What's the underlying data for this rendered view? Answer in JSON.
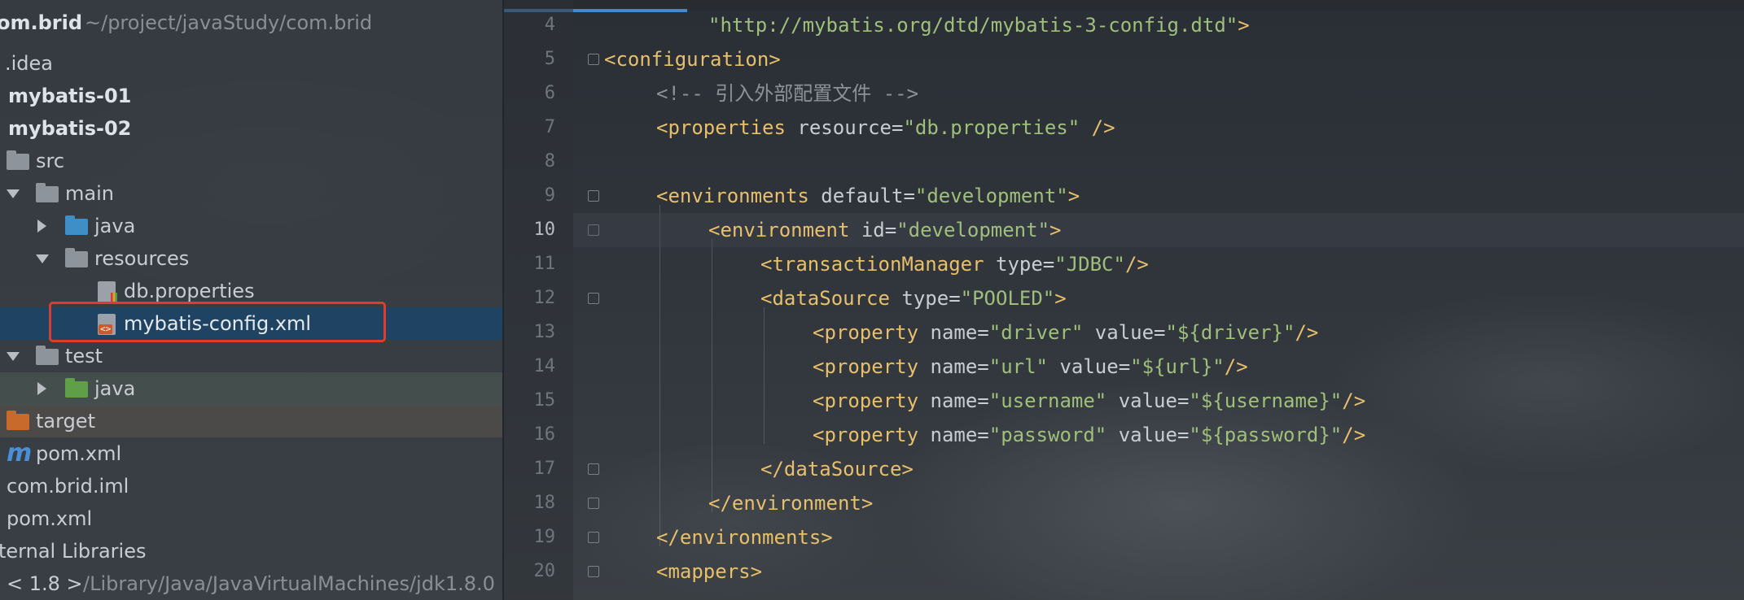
{
  "project_tree": {
    "root": {
      "name": "om.brid",
      "path": "~/project/javaStudy/com.brid"
    },
    "items": [
      {
        "label": ".idea"
      },
      {
        "label": "mybatis-01"
      },
      {
        "label": "mybatis-02"
      },
      {
        "label": "src"
      },
      {
        "label": "main"
      },
      {
        "label": "java"
      },
      {
        "label": "resources"
      },
      {
        "label": "db.properties"
      },
      {
        "label": "mybatis-config.xml"
      },
      {
        "label": "test"
      },
      {
        "label": "java"
      },
      {
        "label": "target"
      },
      {
        "label": "pom.xml"
      },
      {
        "label": "com.brid.iml"
      },
      {
        "label": "pom.xml"
      },
      {
        "label": "ternal Libraries"
      },
      {
        "label": "< 1.8 >",
        "path": "/Library/Java/JavaVirtualMachines/jdk1.8.0"
      }
    ],
    "selected": "mybatis-config.xml"
  },
  "editor": {
    "current_line": "10",
    "lines": [
      {
        "num": "4"
      },
      {
        "num": "5"
      },
      {
        "num": "6"
      },
      {
        "num": "7"
      },
      {
        "num": "8"
      },
      {
        "num": "9"
      },
      {
        "num": "10"
      },
      {
        "num": "11"
      },
      {
        "num": "12"
      },
      {
        "num": "13"
      },
      {
        "num": "14"
      },
      {
        "num": "15"
      },
      {
        "num": "16"
      },
      {
        "num": "17"
      },
      {
        "num": "18"
      },
      {
        "num": "19"
      },
      {
        "num": "20"
      }
    ],
    "code": {
      "l4_val": "\"http://mybatis.org/dtd/mybatis-3-config.dtd\"",
      "l4_close": ">",
      "l5_tag": "<configuration>",
      "l6_comment": "<!-- 引入外部配置文件 -->",
      "l7_tag": "<properties",
      "l7_attr": " resource=",
      "l7_val": "\"db.properties\"",
      "l7_close": " />",
      "l9_tag": "<environments",
      "l9_attr": " default=",
      "l9_val": "\"development\"",
      "l9_close": ">",
      "l10_tag": "<environment",
      "l10_attr": " id=",
      "l10_val": "\"development\"",
      "l10_close": ">",
      "l11_tag": "<transactionManager",
      "l11_attr": " type=",
      "l11_val": "\"JDBC\"",
      "l11_close": "/>",
      "l12_tag": "<dataSource",
      "l12_attr": " type=",
      "l12_val": "\"POOLED\"",
      "l12_close": ">",
      "l13_tag": "<property",
      "l13_attr1": " name=",
      "l13_val1": "\"driver\"",
      "l13_attr2": " value=",
      "l13_val2": "\"${driver}\"",
      "l13_close": "/>",
      "l14_tag": "<property",
      "l14_attr1": " name=",
      "l14_val1": "\"url\"",
      "l14_attr2": " value=",
      "l14_val2": "\"${url}\"",
      "l14_close": "/>",
      "l15_tag": "<property",
      "l15_attr1": " name=",
      "l15_val1": "\"username\"",
      "l15_attr2": " value=",
      "l15_val2": "\"${username}\"",
      "l15_close": "/>",
      "l16_tag": "<property",
      "l16_attr1": " name=",
      "l16_val1": "\"password\"",
      "l16_attr2": " value=",
      "l16_val2": "\"${password}\"",
      "l16_close": "/>",
      "l17_tag": "</dataSource>",
      "l18_tag": "</environment>",
      "l19_tag": "</environments>",
      "l20_tag": "<mappers>"
    }
  },
  "colors": {
    "tag": "#e8bf6a",
    "string": "#9fbf7a",
    "selection": "#1f4463",
    "highlight_box": "#e03b2f"
  }
}
